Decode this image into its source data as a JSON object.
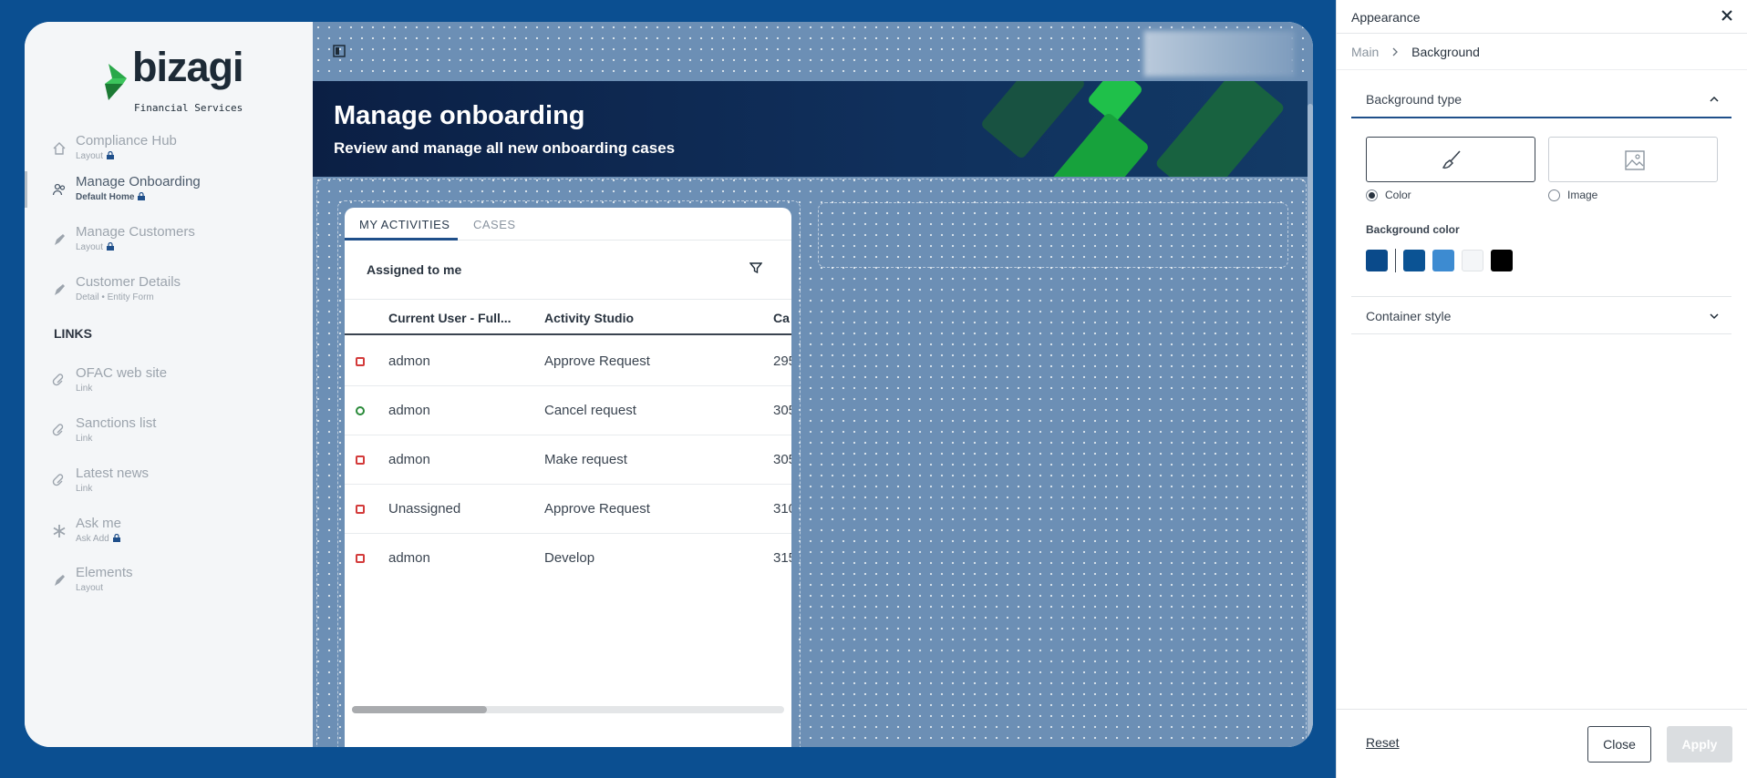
{
  "app": {
    "logo_text": "bizagi",
    "logo_tagline": "Financial Services"
  },
  "sidebar": {
    "items": [
      {
        "label": "Compliance Hub",
        "sub": "Layout",
        "icon": "home-icon",
        "locked": true
      },
      {
        "label": "Manage Onboarding",
        "sub": "Default Home",
        "icon": "people-icon",
        "locked": true,
        "active": true
      },
      {
        "label": "Manage Customers",
        "sub": "Layout",
        "icon": "pen-icon",
        "locked": true
      },
      {
        "label": "Customer Details",
        "sub": "Detail • Entity Form",
        "icon": "pen-icon",
        "locked": false
      }
    ],
    "links_heading": "LINKS",
    "links": [
      {
        "label": "OFAC web site",
        "sub": "Link",
        "icon": "link-icon"
      },
      {
        "label": "Sanctions list",
        "sub": "Link",
        "icon": "link-icon"
      },
      {
        "label": "Latest news",
        "sub": "Link",
        "icon": "link-icon"
      },
      {
        "label": "Ask me",
        "sub": "Ask Add",
        "icon": "asterisk-icon",
        "locked": true
      },
      {
        "label": "Elements",
        "sub": "Layout",
        "icon": "pen-icon"
      }
    ]
  },
  "banner": {
    "title": "Manage onboarding",
    "subtitle": "Review and manage all new onboarding cases"
  },
  "activities": {
    "tabs": [
      "MY ACTIVITIES",
      "CASES"
    ],
    "active_tab": "MY ACTIVITIES",
    "assigned_label": "Assigned to me",
    "columns": [
      "Current User - Full...",
      "Activity Studio",
      "Ca"
    ],
    "rows": [
      {
        "status": "red",
        "user": "admon",
        "activity": "Approve Request",
        "case": "295"
      },
      {
        "status": "green",
        "user": "admon",
        "activity": "Cancel request",
        "case": "305"
      },
      {
        "status": "red",
        "user": "admon",
        "activity": "Make request",
        "case": "305"
      },
      {
        "status": "red",
        "user": "Unassigned",
        "activity": "Approve Request",
        "case": "310"
      },
      {
        "status": "red",
        "user": "admon",
        "activity": "Develop",
        "case": "315"
      }
    ],
    "scroll_position": 0.31
  },
  "panel": {
    "title": "Appearance",
    "breadcrumb": [
      "Main",
      "Background"
    ],
    "section_background_type": "Background type",
    "type_options": [
      "Color",
      "Image"
    ],
    "selected_type": "Color",
    "background_color_label": "Background color",
    "swatches": [
      "#0a4a8a",
      "#0b5394",
      "#3d8bd1",
      "#f4f6f8",
      "#000000"
    ],
    "section_container_style": "Container style",
    "reset_label": "Reset",
    "close_label": "Close",
    "apply_label": "Apply"
  },
  "colors": {
    "canvas_bg": "#0b4f91",
    "accent": "#1f4f8a",
    "banner_green": "#1fc04a"
  }
}
